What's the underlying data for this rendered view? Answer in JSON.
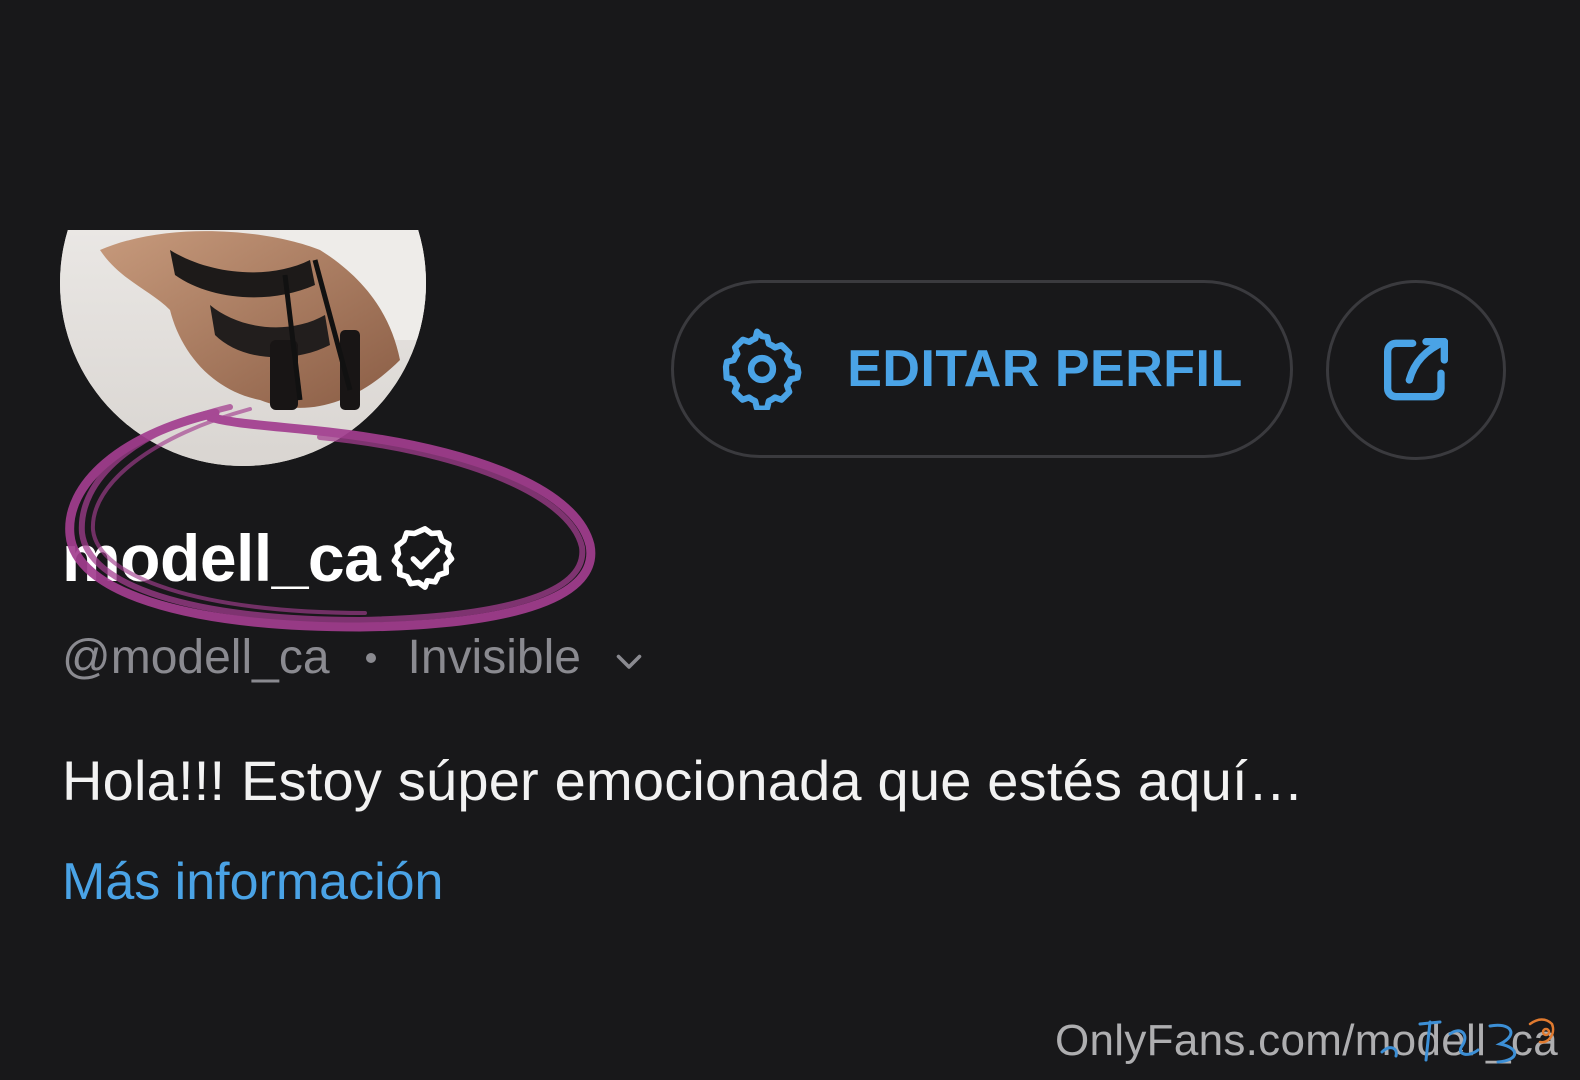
{
  "profile": {
    "display_name": "modell_ca",
    "handle": "@modell_ca",
    "status": "Invisible",
    "bio": "Hola!!! Estoy súper emocionada que estés aquí…",
    "more_info_label": "Más información"
  },
  "actions": {
    "edit_label": "EDITAR PERFIL"
  },
  "watermark": {
    "text": "OnlyFans.com/modell_ca"
  },
  "icons": {
    "edit": "gear-icon",
    "share": "share-icon",
    "verified": "verified-badge-icon",
    "status_toggle": "chevron-down-icon"
  },
  "colors": {
    "background": "#18181a",
    "accent": "#4aa3e6",
    "muted_text": "#8a8a90",
    "primary_text": "#ffffff",
    "button_border": "#3a3a3e",
    "scribble": "#a23d8f"
  }
}
